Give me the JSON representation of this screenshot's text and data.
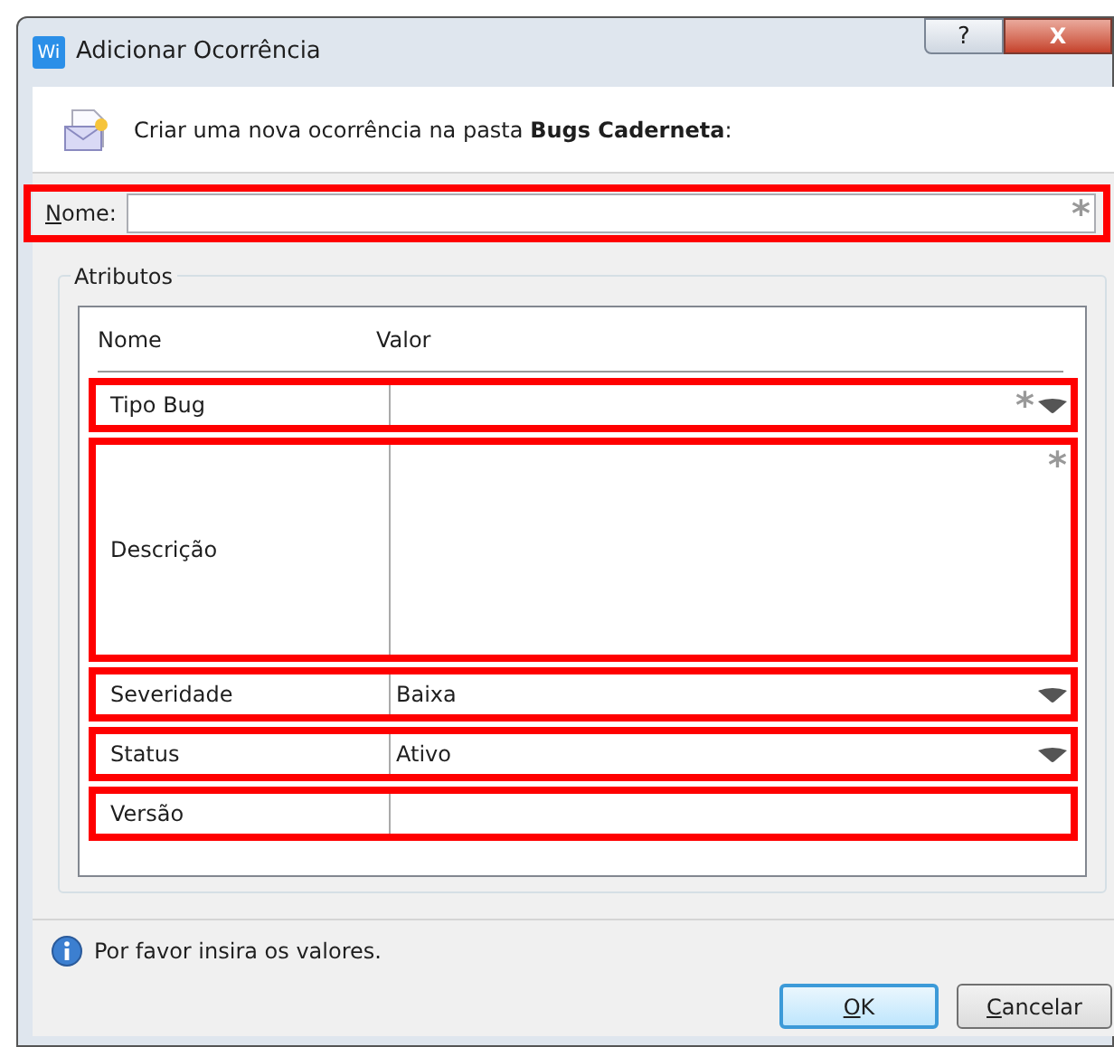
{
  "window": {
    "title": "Adicionar Ocorrência",
    "app_badge": "Wi",
    "help_button": "?",
    "close_button": "X"
  },
  "header": {
    "text": "Criar uma nova ocorrência na pasta **Bugs Caderneta**:"
  },
  "name_field": {
    "label": "Nome:",
    "access_key_underlined": true,
    "required_mark": "*",
    "highlighted": true
  },
  "attributes": {
    "title": "Atributos",
    "columns": [
      "Nome",
      "Valor"
    ],
    "rows": [
      {
        "kind": "dropdown",
        "name": "Tipo Bug",
        "required_mark": "*",
        "highlighted": true
      },
      {
        "kind": "multiline",
        "name": "Descrição",
        "required_mark": "*",
        "highlighted": true
      },
      {
        "kind": "dropdown",
        "name": "Severidade",
        "value": "Baixa",
        "highlighted": true
      },
      {
        "kind": "dropdown",
        "name": "Status",
        "value": "Ativo",
        "highlighted": true
      },
      {
        "kind": "text",
        "name": "Versão",
        "highlighted": true
      }
    ]
  },
  "status_message": "Por favor insira os valores.",
  "buttons": [
    {
      "label": "OK",
      "default": true,
      "access_key_underlined": true
    },
    {
      "label": "Cancelar",
      "default": false,
      "access_key_underlined": true
    }
  ]
}
